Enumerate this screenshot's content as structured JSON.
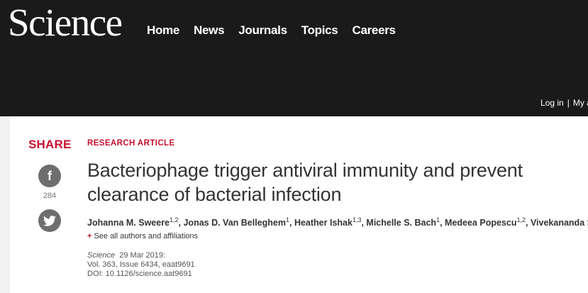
{
  "header": {
    "logo": "Science",
    "nav": [
      "Home",
      "News",
      "Journals",
      "Topics",
      "Careers"
    ],
    "login": "Log in",
    "separator": "|",
    "my_account": "My a"
  },
  "share": {
    "title": "SHARE",
    "facebook_glyph": "f",
    "facebook_count": "284",
    "icons": [
      "facebook-icon",
      "twitter-icon"
    ]
  },
  "article": {
    "kicker": "RESEARCH ARTICLE",
    "title": "Bacteriophage trigger antiviral immunity and prevent clearance of bacterial infection",
    "authors": [
      {
        "name": "Johanna M. Sweere",
        "sup": "1,2"
      },
      {
        "name": "Jonas D. Van Belleghem",
        "sup": "1"
      },
      {
        "name": "Heather Ishak",
        "sup": "1,3"
      },
      {
        "name": "Michelle S. Bach",
        "sup": "1"
      },
      {
        "name": "Medeea Popescu",
        "sup": "1,2"
      },
      {
        "name": "Vivekananda S...",
        "sup": ""
      }
    ],
    "see_all": "See all authors and affiliations",
    "journal": "Science",
    "date": "29 Mar 2019:",
    "volume": "Vol. 363, Issue 6434, eaat9691",
    "doi": "DOI: 10.1126/science.aat9691"
  },
  "colors": {
    "header_bg": "#1a1a1a",
    "accent_red": "#c8102e",
    "icon_gray": "#6e6e6e"
  }
}
